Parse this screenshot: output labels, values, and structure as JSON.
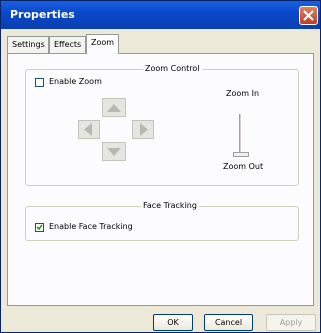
{
  "window": {
    "title": "Properties"
  },
  "tabs": [
    {
      "label": "Settings"
    },
    {
      "label": "Effects"
    },
    {
      "label": "Zoom"
    }
  ],
  "zoom_control": {
    "legend": "Zoom Control",
    "enable_zoom": {
      "label": "Enable Zoom",
      "checked": false
    },
    "zoom_in_label": "Zoom In",
    "zoom_out_label": "Zoom Out",
    "slider_level": 0
  },
  "face_tracking": {
    "legend": "Face Tracking",
    "enable_face_tracking": {
      "label": "Enable Face Tracking",
      "checked": true
    }
  },
  "buttons": {
    "ok": "OK",
    "cancel": "Cancel",
    "apply": "Apply"
  },
  "icons": [
    "close-icon",
    "arrow-up-icon",
    "arrow-left-icon",
    "arrow-right-icon",
    "arrow-down-icon",
    "checkmark-icon"
  ]
}
